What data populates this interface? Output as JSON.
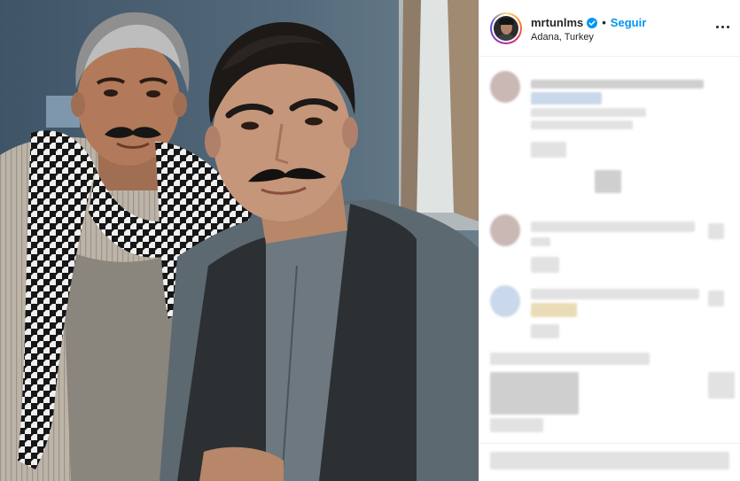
{
  "post": {
    "username": "mrtunlms",
    "follow_label": "Seguir",
    "separator": "•",
    "location": "Adana, Turkey"
  },
  "icons": {
    "verified": "verified-badge-icon",
    "more": "more-options-icon"
  },
  "colors": {
    "follow": "#0095f6",
    "verified": "#0095f6",
    "text": "#262626",
    "border": "#efefef"
  }
}
